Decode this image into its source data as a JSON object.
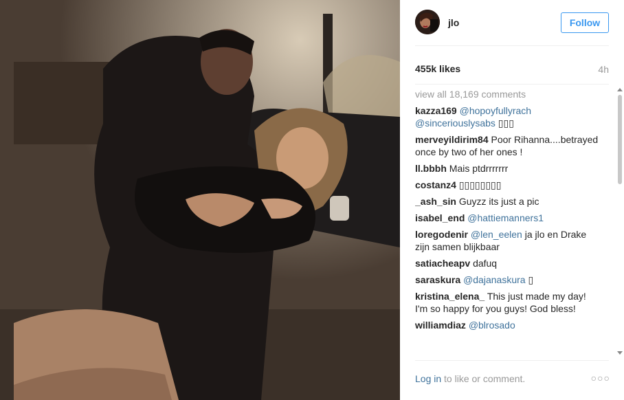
{
  "post": {
    "username": "jlo",
    "follow_label": "Follow",
    "likes": "455k likes",
    "time_ago": "4h",
    "view_all": "view all 18,169 comments",
    "comments": [
      {
        "user": "kazza169",
        "mention": "@hopoyfullyrach @sinceriouslysabs",
        "text": " ▯▯▯"
      },
      {
        "user": "merveyildirim84",
        "mention": "",
        "text": "Poor Rihanna....betrayed once by two of her ones !"
      },
      {
        "user": "ll.bbbh",
        "mention": "",
        "text": "Mais ptdrrrrrrr"
      },
      {
        "user": "costanz4",
        "mention": "",
        "text": "▯▯▯▯▯▯▯▯"
      },
      {
        "user": "_ash_sin",
        "mention": "",
        "text": "Guyzz its just a pic"
      },
      {
        "user": "isabel_end",
        "mention": "@hattiemanners1",
        "text": ""
      },
      {
        "user": "loregodenir",
        "mention": "@len_eelen",
        "text": " ja jlo en Drake zijn samen blijkbaar"
      },
      {
        "user": "satiacheapv",
        "mention": "",
        "text": "dafuq"
      },
      {
        "user": "saraskura",
        "mention": "@dajanaskura",
        "text": " ▯"
      },
      {
        "user": "kristina_elena_",
        "mention": "",
        "text": "This just made my day! I'm so happy for you guys! God bless!"
      },
      {
        "user": "williamdiaz",
        "mention": "@blrosado",
        "text": ""
      }
    ],
    "login_label": "Log in",
    "login_suffix": " to like or comment.",
    "more_label": "○○○"
  }
}
